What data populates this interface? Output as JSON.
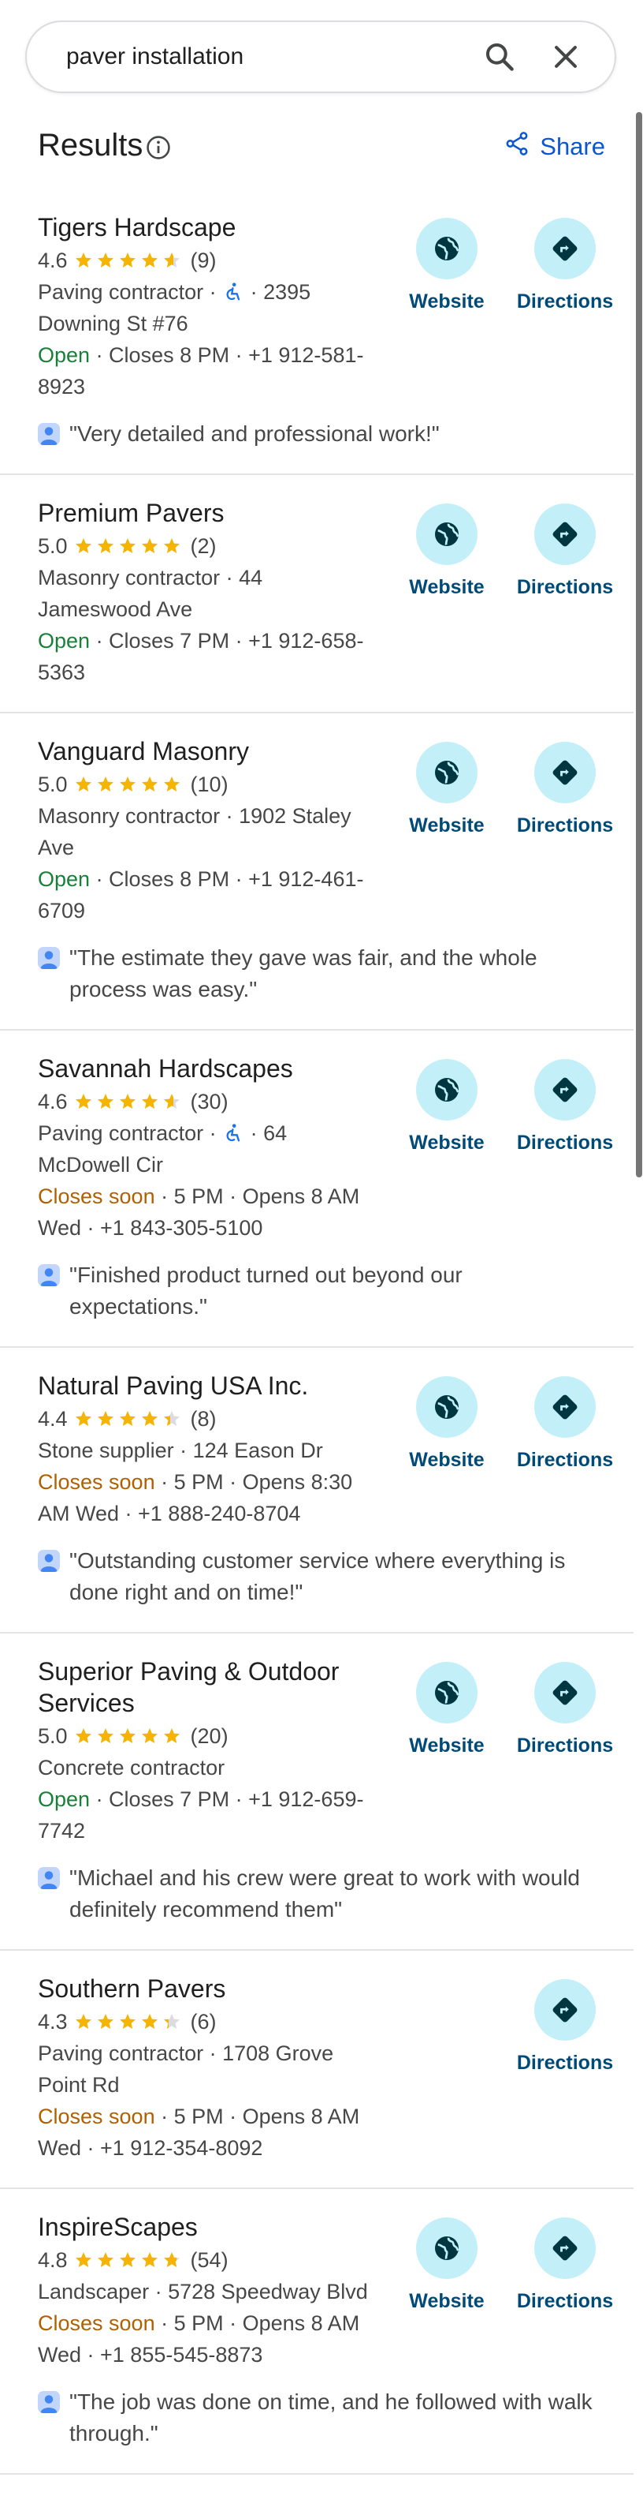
{
  "search": {
    "query": "paver installation"
  },
  "header": {
    "title": "Results",
    "share_label": "Share"
  },
  "actions": {
    "website_label": "Website",
    "directions_label": "Directions"
  },
  "colors": {
    "accent": "#0b57d0",
    "star": "#f5b400",
    "open": "#188038",
    "closes_soon": "#b06000",
    "action_bg": "#c3f0f8"
  },
  "results": [
    {
      "name": "Tigers Hardscape",
      "rating": "4.6",
      "stars": 4.6,
      "reviews": "(9)",
      "type_line": "Paving contractor · ",
      "accessible_icon": true,
      "addr_line": "· 2395 Downing St #76",
      "status": "Open",
      "status_kind": "open",
      "hours_line": " · Closes 8 PM · +1 912-581-8923",
      "review": "\"Very detailed and professional work!\"",
      "has_website": true
    },
    {
      "name": "Premium Pavers",
      "rating": "5.0",
      "stars": 5,
      "reviews": "(2)",
      "type_line": "Masonry contractor · 44 Jameswood Ave",
      "accessible_icon": false,
      "addr_line": "",
      "status": "Open",
      "status_kind": "open",
      "hours_line": " · Closes 7 PM · +1 912-658-5363",
      "review": "",
      "has_website": true
    },
    {
      "name": "Vanguard Masonry",
      "rating": "5.0",
      "stars": 5,
      "reviews": "(10)",
      "type_line": "Masonry contractor · 1902 Staley Ave",
      "accessible_icon": false,
      "addr_line": "",
      "status": "Open",
      "status_kind": "open",
      "hours_line": " · Closes 8 PM · +1 912-461-6709",
      "review": "\"The estimate they gave was fair, and the whole process was easy.\"",
      "has_website": true
    },
    {
      "name": "Savannah Hardscapes",
      "rating": "4.6",
      "stars": 4.6,
      "reviews": "(30)",
      "type_line": "Paving contractor · ",
      "accessible_icon": true,
      "addr_line": "· 64 McDowell Cir",
      "status": "Closes soon",
      "status_kind": "soon",
      "hours_line": " · 5 PM · Opens 8 AM Wed · +1 843-305-5100",
      "review": "\"Finished product turned out beyond our expectations.\"",
      "has_website": true
    },
    {
      "name": "Natural Paving USA Inc.",
      "rating": "4.4",
      "stars": 4.4,
      "reviews": "(8)",
      "type_line": "Stone supplier · 124 Eason Dr",
      "accessible_icon": false,
      "addr_line": "",
      "status": "Closes soon",
      "status_kind": "soon",
      "hours_line": " · 5 PM · Opens 8:30 AM Wed · +1 888-240-8704",
      "review": "\"Outstanding customer service where everything is done right and on time!\"",
      "has_website": true
    },
    {
      "name": "Superior Paving & Outdoor Services",
      "rating": "5.0",
      "stars": 5,
      "reviews": "(20)",
      "type_line": "Concrete contractor",
      "accessible_icon": false,
      "addr_line": "",
      "status": "Open",
      "status_kind": "open",
      "hours_line": " · Closes 7 PM · +1 912-659-7742",
      "review": "\"Michael and his crew were great to work with would definitely recommend them\"",
      "has_website": true
    },
    {
      "name": "Southern Pavers",
      "rating": "4.3",
      "stars": 4.3,
      "reviews": "(6)",
      "type_line": "Paving contractor · 1708 Grove Point Rd",
      "accessible_icon": false,
      "addr_line": "",
      "status": "Closes soon",
      "status_kind": "soon",
      "hours_line": " · 5 PM · Opens 8 AM Wed · +1 912-354-8092",
      "review": "",
      "has_website": false
    },
    {
      "name": "InspireScapes",
      "rating": "4.8",
      "stars": 4.8,
      "reviews": "(54)",
      "type_line": "Landscaper · 5728 Speedway Blvd",
      "accessible_icon": false,
      "addr_line": "",
      "status": "Closes soon",
      "status_kind": "soon",
      "hours_line": " · 5 PM · Opens 8 AM Wed · +1 855-545-8873",
      "review": "\"The job was done on time, and he followed with walk through.\"",
      "has_website": true
    }
  ]
}
